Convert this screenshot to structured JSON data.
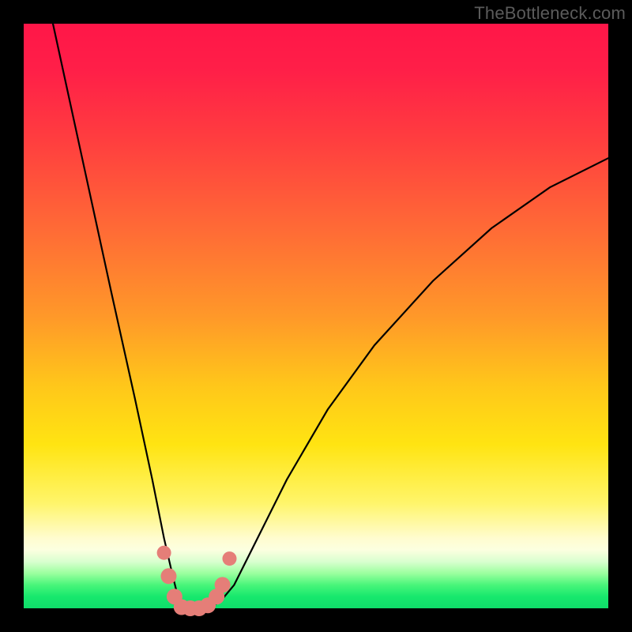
{
  "watermark": "TheBottleneck.com",
  "chart_data": {
    "type": "line",
    "title": "",
    "xlabel": "",
    "ylabel": "",
    "xlim": [
      0,
      1
    ],
    "ylim": [
      0,
      1
    ],
    "notes": "V-shaped bottleneck curve over red-to-green vertical gradient. Axes unlabeled. Values are normalized 0..1 (x left→right, y bottom→top).",
    "series": [
      {
        "name": "bottleneck-curve",
        "x": [
          0.05,
          0.1,
          0.15,
          0.19,
          0.22,
          0.24,
          0.255,
          0.265,
          0.275,
          0.29,
          0.31,
          0.335,
          0.36,
          0.4,
          0.45,
          0.52,
          0.6,
          0.7,
          0.8,
          0.9,
          1.0
        ],
        "y": [
          1.0,
          0.77,
          0.54,
          0.36,
          0.22,
          0.12,
          0.055,
          0.015,
          0.0,
          0.0,
          0.0,
          0.01,
          0.04,
          0.12,
          0.22,
          0.34,
          0.45,
          0.56,
          0.65,
          0.72,
          0.77
        ]
      }
    ],
    "markers": {
      "name": "highlight-points",
      "color": "#e57e78",
      "x": [
        0.24,
        0.248,
        0.258,
        0.27,
        0.285,
        0.3,
        0.315,
        0.33,
        0.34,
        0.352
      ],
      "y": [
        0.095,
        0.055,
        0.02,
        0.002,
        0.0,
        0.0,
        0.005,
        0.02,
        0.04,
        0.085
      ]
    },
    "background_gradient": {
      "orientation": "vertical",
      "stops": [
        {
          "pos": 0.0,
          "color": "#ff1648"
        },
        {
          "pos": 0.35,
          "color": "#ff6a36"
        },
        {
          "pos": 0.62,
          "color": "#ffc71a"
        },
        {
          "pos": 0.88,
          "color": "#fffccf"
        },
        {
          "pos": 0.96,
          "color": "#49f57a"
        },
        {
          "pos": 1.0,
          "color": "#0fdd6a"
        }
      ]
    }
  }
}
